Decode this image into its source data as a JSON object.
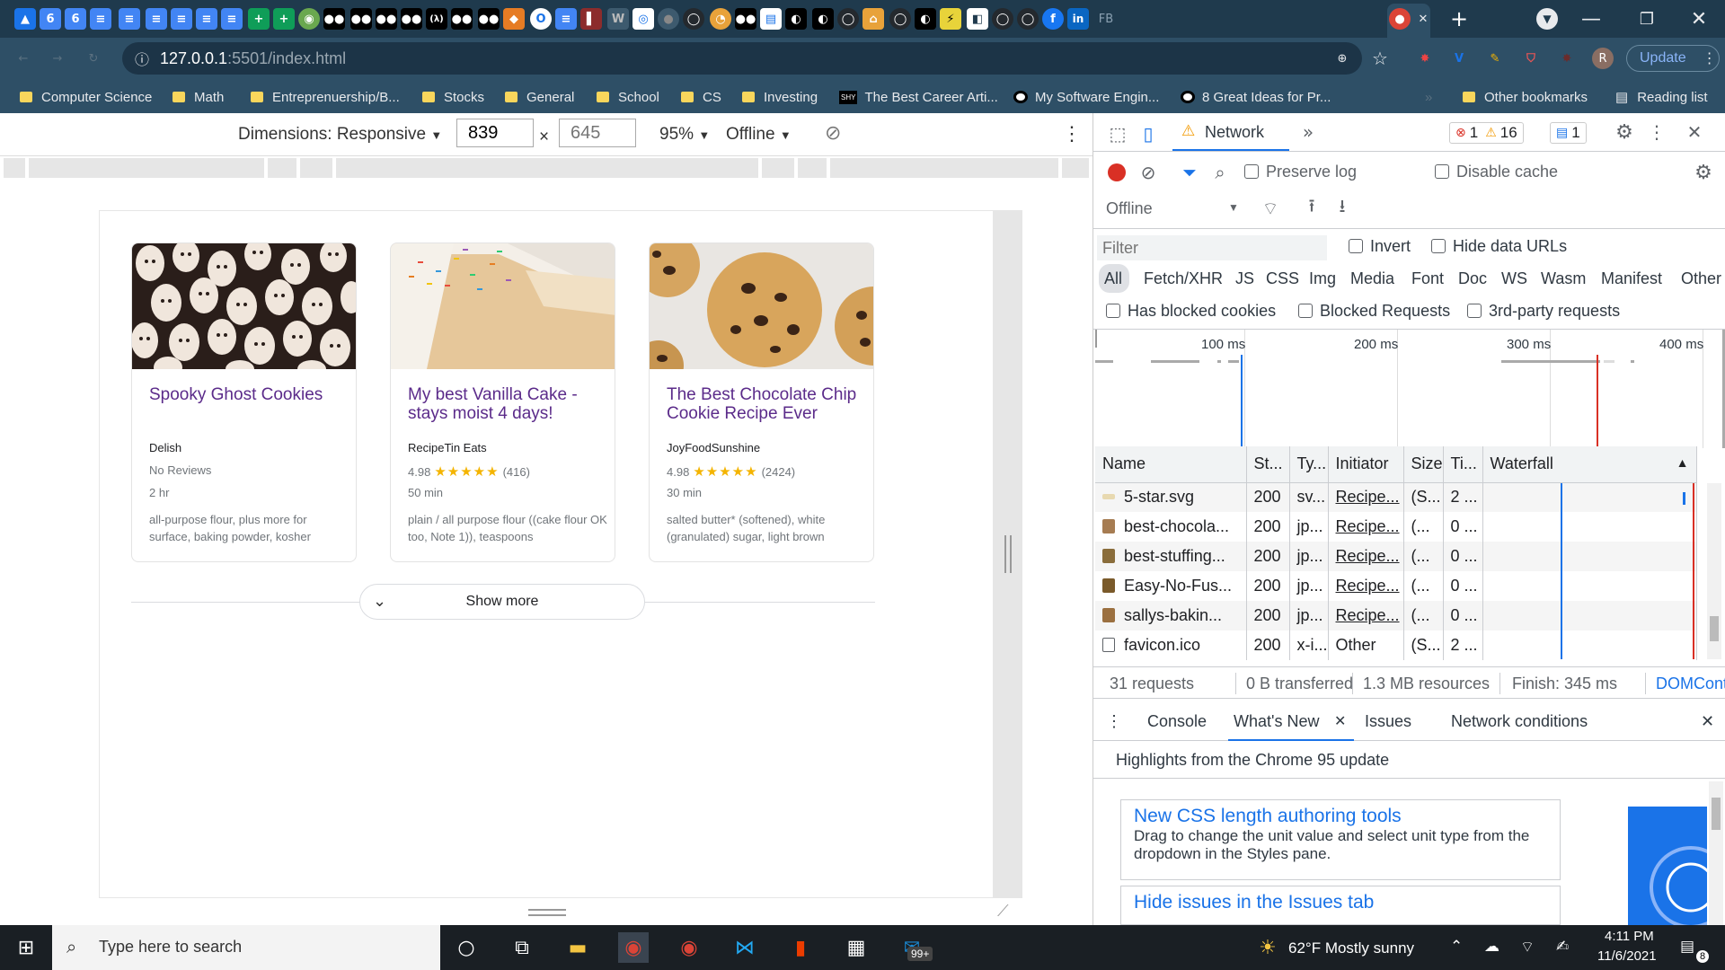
{
  "browser": {
    "url_host": "127.0.0.1",
    "url_path": ":5501/index.html",
    "update_label": "Update",
    "profile_initial": "R",
    "bookmarks": [
      {
        "label": "Computer Science",
        "type": "folder"
      },
      {
        "label": "Math",
        "type": "folder"
      },
      {
        "label": "Entreprenuership/B...",
        "type": "folder"
      },
      {
        "label": "Stocks",
        "type": "folder"
      },
      {
        "label": "General",
        "type": "folder"
      },
      {
        "label": "School",
        "type": "folder"
      },
      {
        "label": "CS",
        "type": "folder"
      },
      {
        "label": "Investing",
        "type": "folder"
      },
      {
        "label": "The Best Career Arti...",
        "type": "page"
      },
      {
        "label": "My Software Engin...",
        "type": "medium"
      },
      {
        "label": "8 Great Ideas for Pr...",
        "type": "medium"
      }
    ],
    "other_bookmarks": "Other bookmarks",
    "reading_list": "Reading list",
    "tab_fb_label": "FB"
  },
  "device_toolbar": {
    "dimensions_label": "Dimensions: Responsive",
    "width": "839",
    "height_placeholder": "645",
    "times": "×",
    "zoom": "95%",
    "throttle": "Offline"
  },
  "recipes": [
    {
      "title": "Spooky Ghost Cookies",
      "source": "Delish",
      "rating_text": "No Reviews",
      "rating": "",
      "count": "",
      "time": "2 hr",
      "ingredients": "all-purpose flour, plus more for surface, baking powder, kosher"
    },
    {
      "title": "My best Vanilla Cake - stays moist 4 days!",
      "source": "RecipeTin Eats",
      "rating_text": "",
      "rating": "4.98",
      "count": "(416)",
      "time": "50 min",
      "ingredients": "plain / all purpose flour ((cake flour OK too, Note 1)), teaspoons"
    },
    {
      "title": "The Best Chocolate Chip Cookie Recipe Ever",
      "source": "JoyFoodSunshine",
      "rating_text": "",
      "rating": "4.98",
      "count": "(2424)",
      "time": "30 min",
      "ingredients": "salted butter* (softened), white (granulated) sugar, light brown"
    }
  ],
  "stars": "★★★★★",
  "show_more": "Show more",
  "devtools": {
    "panel_tab": "Network",
    "errors": "1",
    "warnings": "16",
    "messages": "1",
    "preserve_log": "Preserve log",
    "disable_cache": "Disable cache",
    "throttle": "Offline",
    "filter_placeholder": "Filter",
    "invert": "Invert",
    "hide_data_urls": "Hide data URLs",
    "types": [
      "All",
      "Fetch/XHR",
      "JS",
      "CSS",
      "Img",
      "Media",
      "Font",
      "Doc",
      "WS",
      "Wasm",
      "Manifest",
      "Other"
    ],
    "has_blocked_cookies": "Has blocked cookies",
    "blocked_requests": "Blocked Requests",
    "third_party": "3rd-party requests",
    "timeline_ticks": [
      "100 ms",
      "200 ms",
      "300 ms",
      "400 ms"
    ],
    "columns": [
      "Name",
      "St...",
      "Ty...",
      "Initiator",
      "Size",
      "Ti...",
      "Waterfall"
    ],
    "rows": [
      {
        "name": "5-star.svg",
        "status": "200",
        "type": "sv...",
        "initiator": "Recipe...",
        "size": "(S...",
        "time": "2 ...",
        "icon": "#e8d9b0"
      },
      {
        "name": "best-chocola...",
        "status": "200",
        "type": "jp...",
        "initiator": "Recipe...",
        "size": "(...",
        "time": "0 ...",
        "icon": "#a67c52"
      },
      {
        "name": "best-stuffing...",
        "status": "200",
        "type": "jp...",
        "initiator": "Recipe...",
        "size": "(...",
        "time": "0 ...",
        "icon": "#8a6d3b"
      },
      {
        "name": "Easy-No-Fus...",
        "status": "200",
        "type": "jp...",
        "initiator": "Recipe...",
        "size": "(...",
        "time": "0 ...",
        "icon": "#7a5a2a"
      },
      {
        "name": "sallys-bakin...",
        "status": "200",
        "type": "jp...",
        "initiator": "Recipe...",
        "size": "(...",
        "time": "0 ...",
        "icon": "#9b7040"
      },
      {
        "name": "favicon.ico",
        "status": "200",
        "type": "x-i...",
        "initiator": "Other",
        "size": "(S...",
        "time": "2 ...",
        "icon": "#ffffff"
      }
    ],
    "summary": {
      "requests": "31 requests",
      "transferred": "0 B transferred",
      "resources": "1.3 MB resources",
      "finish": "Finish: 345 ms",
      "domcontent": "DOMConte"
    },
    "drawer_tabs": [
      "Console",
      "What's New",
      "Issues",
      "Network conditions"
    ],
    "whats_new_heading": "Highlights from the Chrome 95 update",
    "news": [
      {
        "title": "New CSS length authoring tools",
        "desc": "Drag to change the unit value and select unit type from the dropdown in the Styles pane."
      },
      {
        "title": "Hide issues in the Issues tab",
        "desc": ""
      }
    ]
  },
  "taskbar": {
    "search_placeholder": "Type here to search",
    "weather": "62°F  Mostly sunny",
    "time": "4:11 PM",
    "date": "11/6/2021",
    "mail_badge": "99+",
    "notif_count": "8"
  },
  "colors": {
    "chrome_dark": "#1f3a4d",
    "chrome_toolbar": "#2e4f66",
    "recipe_link": "#5b2b8a",
    "star": "#f4b400",
    "devtools_blue": "#1a73e8",
    "record_red": "#d93025"
  }
}
